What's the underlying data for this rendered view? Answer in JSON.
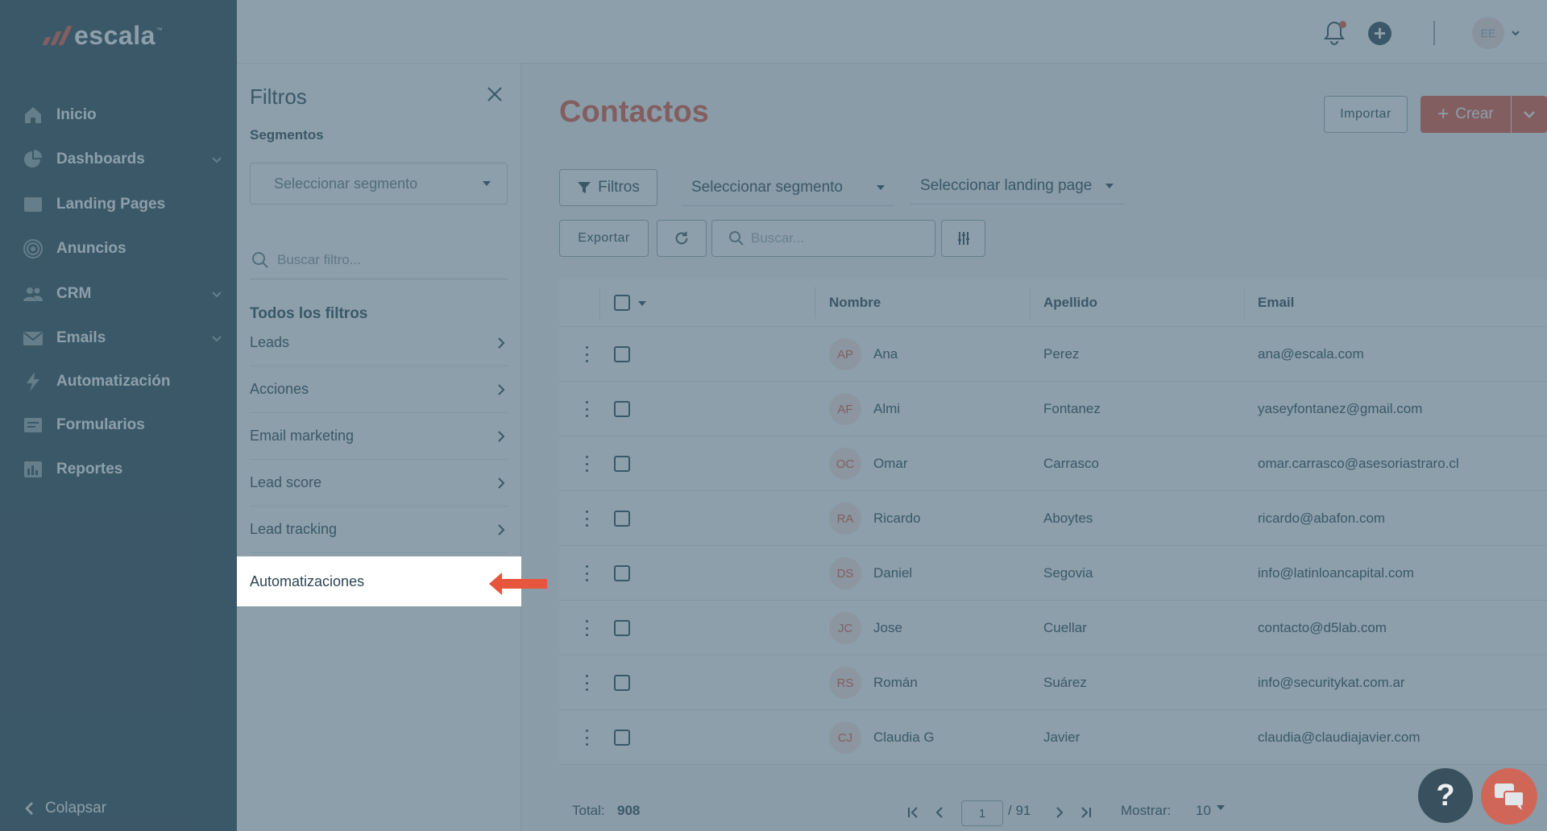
{
  "brand": {
    "name": "escala",
    "tm": "™",
    "accent": "#e8553d",
    "sidebar_bg": "#2c4452"
  },
  "sidebar": {
    "items": [
      {
        "label": "Inicio",
        "icon": "home-icon",
        "has_chevron": false
      },
      {
        "label": "Dashboards",
        "icon": "pie-chart-icon",
        "has_chevron": true
      },
      {
        "label": "Landing Pages",
        "icon": "browser-window-icon",
        "has_chevron": false
      },
      {
        "label": "Anuncios",
        "icon": "target-icon",
        "has_chevron": false
      },
      {
        "label": "CRM",
        "icon": "users-icon",
        "has_chevron": true
      },
      {
        "label": "Emails",
        "icon": "envelope-icon",
        "has_chevron": true
      },
      {
        "label": "Automatización",
        "icon": "lightning-icon",
        "has_chevron": false
      },
      {
        "label": "Formularios",
        "icon": "form-icon",
        "has_chevron": false
      },
      {
        "label": "Reportes",
        "icon": "bar-report-icon",
        "has_chevron": false
      }
    ],
    "collapse_label": "Colapsar"
  },
  "topbar": {
    "avatar_initials": "EE"
  },
  "filters_panel": {
    "title": "Filtros",
    "segments_label": "Segmentos",
    "segment_placeholder": "Seleccionar segmento",
    "search_placeholder": "Buscar filtro...",
    "all_filters_label": "Todos los filtros",
    "items": [
      "Leads",
      "Acciones",
      "Email marketing",
      "Lead score",
      "Lead tracking"
    ],
    "highlighted_item": "Automatizaciones"
  },
  "main": {
    "title": "Contactos",
    "import_label": "Importar",
    "create_label": "Crear",
    "filters_button": "Filtros",
    "segment_dropdown": "Seleccionar segmento",
    "landing_dropdown": "Seleccionar landing page",
    "export_label": "Exportar",
    "search_placeholder": "Buscar..."
  },
  "table": {
    "columns": [
      "Nombre",
      "Apellido",
      "Email"
    ],
    "rows": [
      {
        "initials": "AP",
        "nombre": "Ana",
        "apellido": "Perez",
        "email": "ana@escala.com"
      },
      {
        "initials": "AF",
        "nombre": "Almi",
        "apellido": "Fontanez",
        "email": "yaseyfontanez@gmail.com"
      },
      {
        "initials": "OC",
        "nombre": "Omar",
        "apellido": "Carrasco",
        "email": "omar.carrasco@asesoriastraro.cl"
      },
      {
        "initials": "RA",
        "nombre": "Ricardo",
        "apellido": "Aboytes",
        "email": "ricardo@abafon.com"
      },
      {
        "initials": "DS",
        "nombre": "Daniel",
        "apellido": "Segovia",
        "email": "info@latinloancapital.com"
      },
      {
        "initials": "JC",
        "nombre": "Jose",
        "apellido": "Cuellar",
        "email": "contacto@d5lab.com"
      },
      {
        "initials": "RS",
        "nombre": "Román",
        "apellido": "Suárez",
        "email": "info@securitykat.com.ar"
      },
      {
        "initials": "CJ",
        "nombre": "Claudia G",
        "apellido": "Javier",
        "email": "claudia@claudiajavier.com"
      }
    ]
  },
  "footer": {
    "total_label": "Total:",
    "total_value": "908",
    "page_current": "1",
    "page_total": "/ 91",
    "show_label": "Mostrar:",
    "show_value": "10"
  }
}
